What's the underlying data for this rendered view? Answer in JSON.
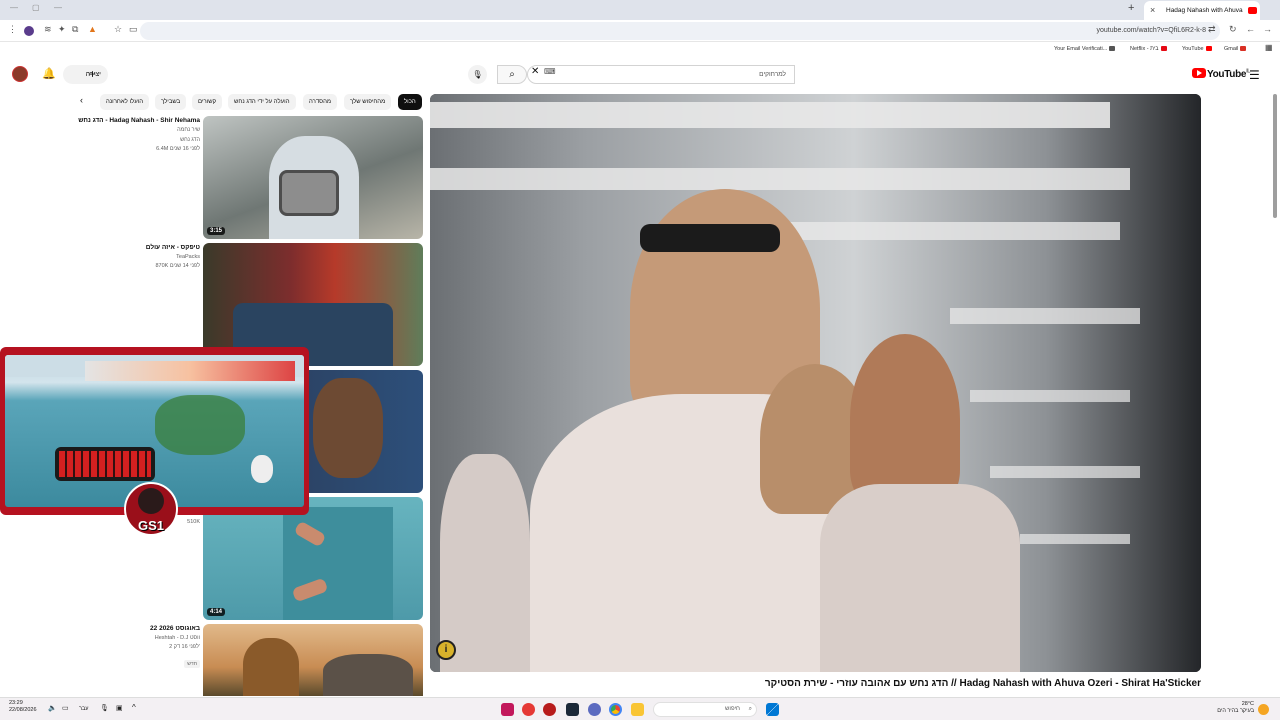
{
  "browser": {
    "tab_title": "Hadag Nahash with Ahuva",
    "tab_close": "×",
    "new_tab": "+",
    "url": "youtube.com/watch?v=QfiL6R2-k-8"
  },
  "bookmarks": [
    {
      "label": "Your Email Verificati...",
      "color": "#555555"
    },
    {
      "label": "Netflix - בית",
      "color": "#e50914"
    },
    {
      "label": "YouTube",
      "color": "#ff0000"
    },
    {
      "label": "Gmail",
      "color": "#d93025"
    }
  ],
  "masthead": {
    "logo_text": "YouTube",
    "logo_sup": "IL",
    "search_placeholder": "למרחוקים",
    "create_label": "יצירה"
  },
  "chips": [
    {
      "label": "הכול",
      "active": true
    },
    {
      "label": "מהחיפוש שלך",
      "active": false
    },
    {
      "label": "מהסדרה",
      "active": false
    },
    {
      "label": "הועלה על ידי הדג נחש",
      "active": false
    },
    {
      "label": "קשורים",
      "active": false
    },
    {
      "label": "בשבילך",
      "active": false
    },
    {
      "label": "הועלו לאחרונה",
      "active": false
    }
  ],
  "recommendations": [
    {
      "title": "הדג נחש - Hadag Nahash - Shir Nehama",
      "channel": "שיר נחמה",
      "sub": "הדג נחש",
      "stats": "6.4M  לפני 16 שנים",
      "duration": "3:15",
      "colors": [
        "#bfc4c2",
        "#6f7774",
        "#b8b5a8"
      ]
    },
    {
      "title": "טיפקס - איזה עולם",
      "channel": "TeaPacks",
      "sub": "",
      "stats": "870K  לפני 14 שנים",
      "duration": "",
      "colors": [
        "#3a3a2a",
        "#7d2d2d",
        "#5f7d5a"
      ]
    },
    {
      "title": "",
      "channel": "",
      "sub": "",
      "stats": "",
      "duration": "",
      "colors": [
        "#2a3a55",
        "#c9a27d",
        "#2d4f7a"
      ]
    },
    {
      "title": "",
      "channel": "",
      "sub": "",
      "stats": "510K",
      "duration": "4:14",
      "colors": [
        "#58a7b7",
        "#4e9aa9",
        "#67b4bf"
      ]
    },
    {
      "title": "22 באוגוסט 2026",
      "channel": "Heshtah - D.J ווסט",
      "sub": "",
      "stats": "2  לפני 16 דק'",
      "badge": "חדש",
      "duration": "",
      "colors": [
        "#e1b98a",
        "#c88c53",
        "#5a4a2c"
      ]
    }
  ],
  "video": {
    "title": "הדג נחש עם אהובה עוזרי - שירת הסטיקר // Hadag Nahash with Ahuva Ozeri - Shirat Ha'Sticker",
    "info_glyph": "i"
  },
  "overlay": {
    "badge_text": "GS1"
  },
  "taskbar": {
    "time": "23:29",
    "date": "22/08/2026",
    "search_label": "חיפוש",
    "lang": "עבר",
    "weather_temp": "28°C",
    "weather_desc": "בעיקר בהיר הים"
  }
}
